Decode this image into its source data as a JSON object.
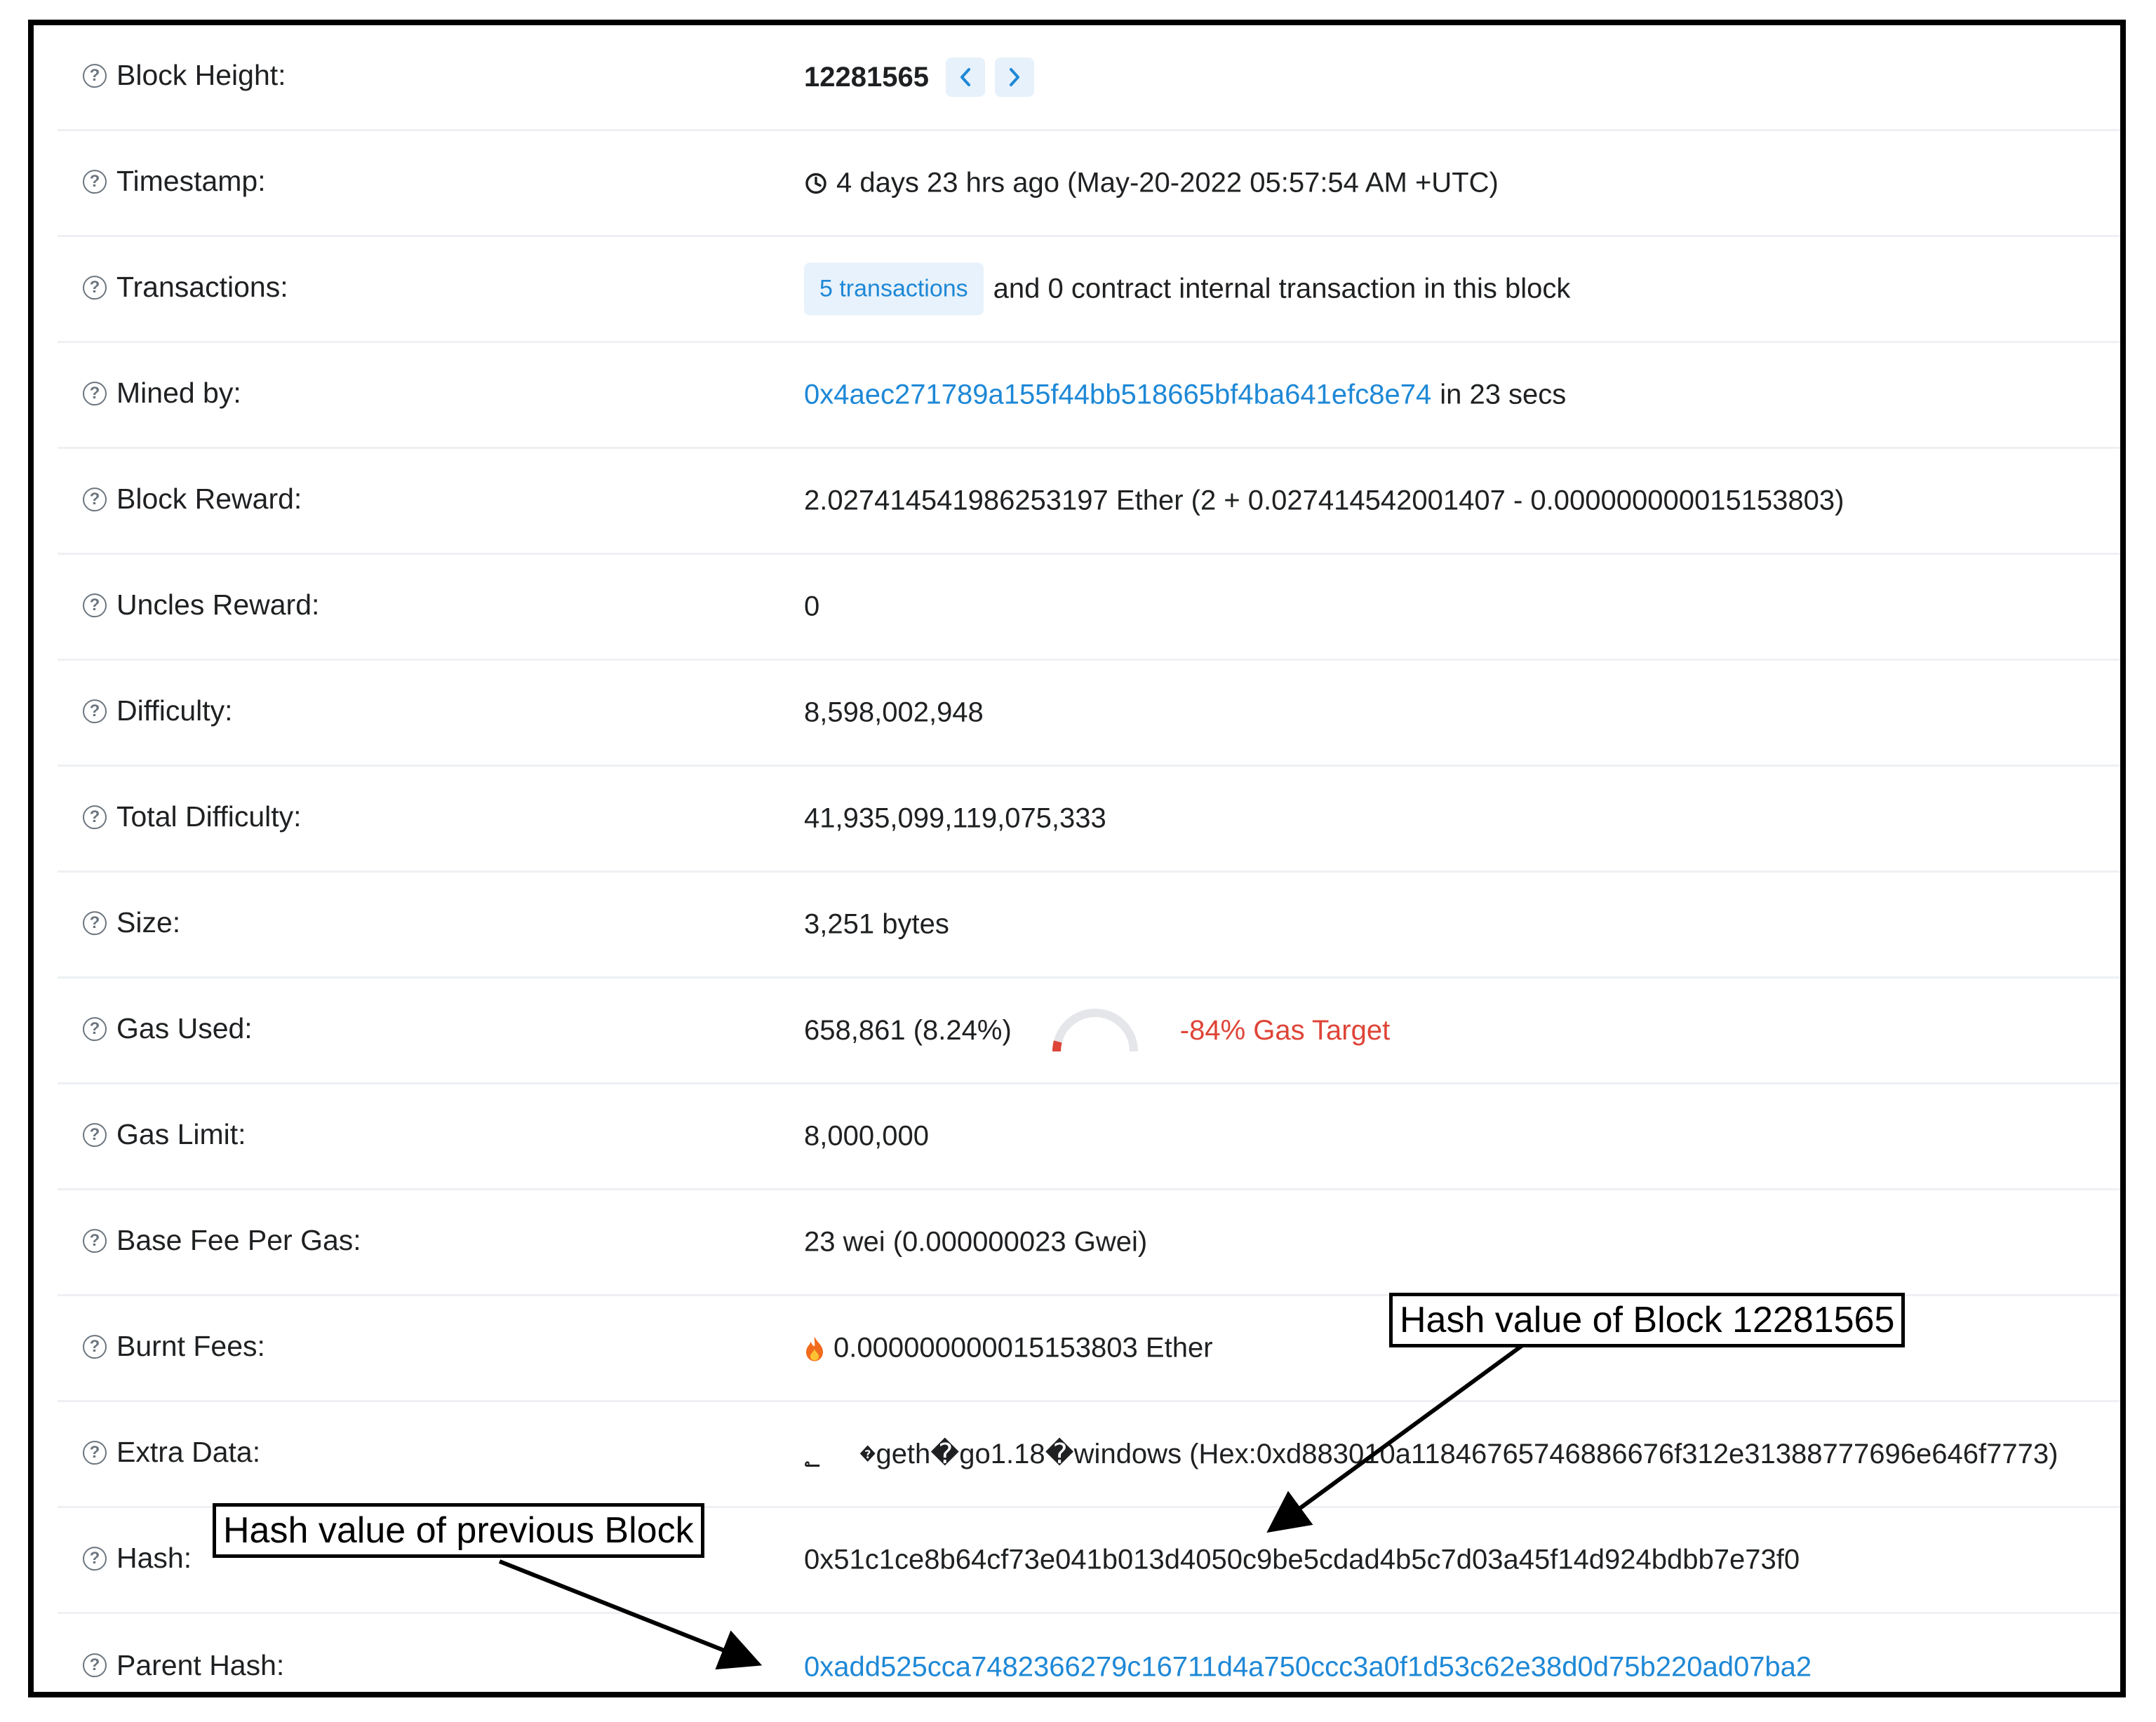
{
  "rows": {
    "block_height": {
      "label": "Block Height:",
      "value": "12281565"
    },
    "timestamp": {
      "label": "Timestamp:",
      "value": "4 days 23 hrs ago (May-20-2022 05:57:54 AM +UTC)"
    },
    "transactions": {
      "label": "Transactions:",
      "badge": "5 transactions",
      "text": "and 0 contract internal transaction in this block"
    },
    "mined_by": {
      "label": "Mined by:",
      "address": "0x4aec271789a155f44bb518665bf4ba641efc8e74",
      "suffix": "in 23 secs"
    },
    "block_reward": {
      "label": "Block Reward:",
      "value": "2.027414541986253197 Ether (2 + 0.027414542001407 - 0.000000000015153803)"
    },
    "uncles_reward": {
      "label": "Uncles Reward:",
      "value": "0"
    },
    "difficulty": {
      "label": "Difficulty:",
      "value": "8,598,002,948"
    },
    "total_difficulty": {
      "label": "Total Difficulty:",
      "value": "41,935,099,119,075,333"
    },
    "size": {
      "label": "Size:",
      "value": "3,251 bytes"
    },
    "gas_used": {
      "label": "Gas Used:",
      "value": "658,861 (8.24%)",
      "gauge_fraction": 0.0824,
      "target": "-84% Gas Target"
    },
    "gas_limit": {
      "label": "Gas Limit:",
      "value": "8,000,000"
    },
    "base_fee": {
      "label": "Base Fee Per Gas:",
      "value": "23 wei (0.000000023 Gwei)"
    },
    "burnt_fees": {
      "label": "Burnt Fees:",
      "value": "0.000000000015153803 Ether"
    },
    "extra_data": {
      "label": "Extra Data:",
      "value": "؂     �geth�go1.18�windows (Hex:0xd883010a11846765746886676f312e31388777696e646f7773)"
    },
    "hash": {
      "label": "Hash:",
      "value": "0x51c1ce8b64cf73e041b013d4050c9be5cdad4b5c7d03a45f14d924bdbb7e73f0"
    },
    "parent_hash": {
      "label": "Parent Hash:",
      "value": "0xadd525cca7482366279c16711d4a750ccc3a0f1d53c62e38d0d75b220ad07ba2"
    }
  },
  "annotations": {
    "block_hash_note": "Hash value of Block 12281565",
    "prev_hash_note": "Hash value of previous Block"
  },
  "icons": {
    "help": "question-circle",
    "clock": "clock",
    "fire": "fire",
    "prev": "chevron-left",
    "next": "chevron-right"
  },
  "colors": {
    "link": "#1e88d6",
    "alert": "#de4437",
    "text": "#1e2022",
    "badge_bg": "#e8f2fc",
    "divider": "#eef0f3"
  }
}
